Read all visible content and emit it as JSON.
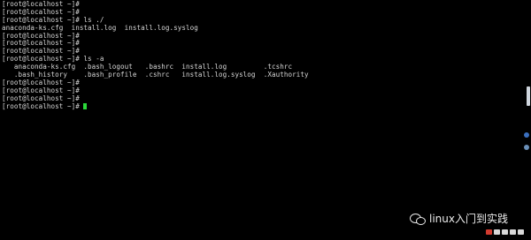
{
  "terminal": {
    "lines": [
      "[root@localhost ~]#",
      "[root@localhost ~]#",
      "[root@localhost ~]# ls ./",
      "anaconda-ks.cfg  install.log  install.log.syslog",
      "[root@localhost ~]#",
      "[root@localhost ~]#",
      "[root@localhost ~]#",
      "[root@localhost ~]# ls -a",
      "   anaconda-ks.cfg  .bash_logout   .bashrc  install.log         .tcshrc",
      "   .bash_history    .bash_profile  .cshrc   install.log.syslog  .Xauthority",
      "[root@localhost ~]#",
      "[root@localhost ~]#",
      "[root@localhost ~]#",
      "[root@localhost ~]# "
    ]
  },
  "watermark": {
    "text": "linux入门到实践"
  },
  "colors": {
    "background": "#000000",
    "text": "#d6d6d6",
    "cursor": "#2bd93a"
  }
}
